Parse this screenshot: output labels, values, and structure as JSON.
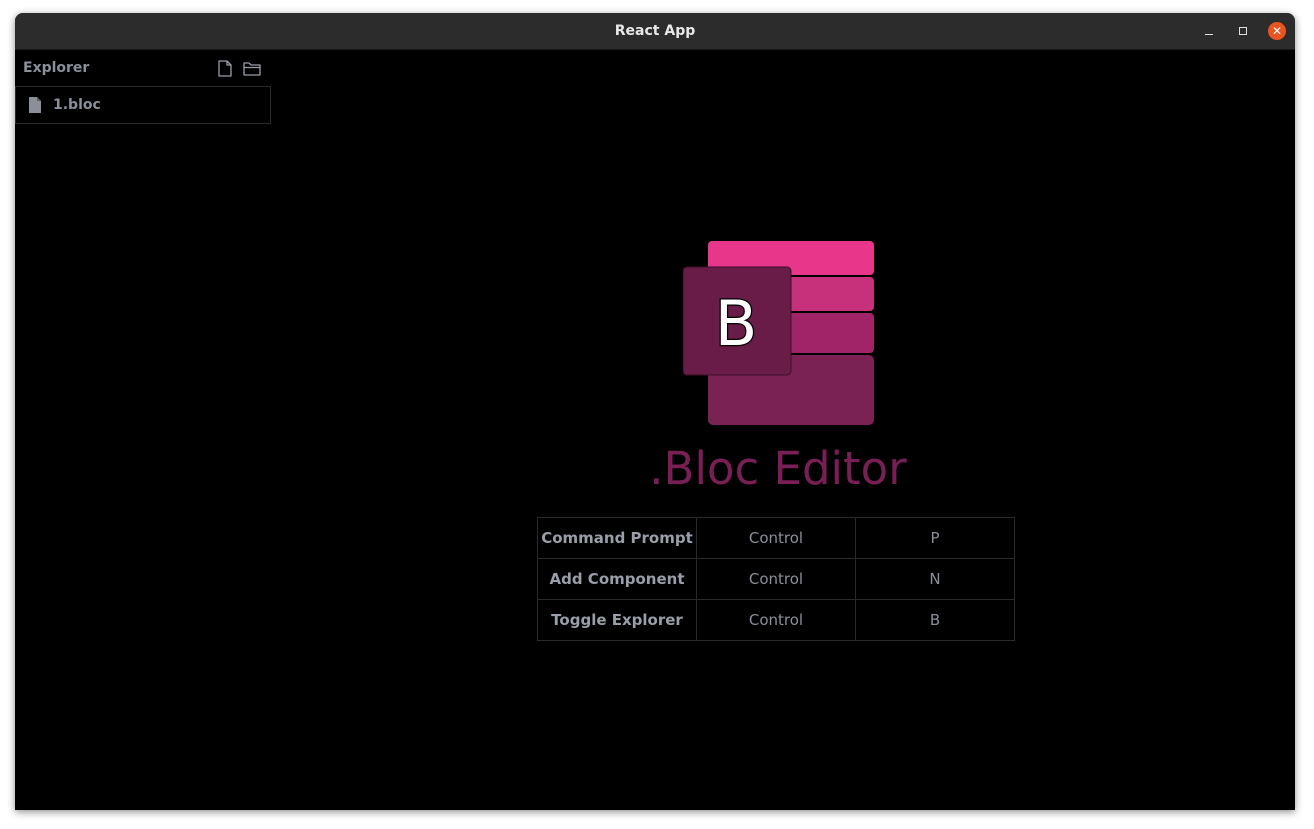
{
  "window": {
    "title": "React App"
  },
  "sidebar": {
    "title": "Explorer",
    "header_icons": [
      "new-file-icon",
      "new-folder-icon"
    ],
    "files": [
      {
        "label": "1.bloc",
        "icon": "file-icon"
      }
    ]
  },
  "main": {
    "logo": {
      "letter": "B",
      "colors": [
        "#e8378a",
        "#c7307b",
        "#a22468",
        "#7b2254",
        "#6a1c48"
      ]
    },
    "brand_title": ".Bloc Editor",
    "shortcuts": [
      {
        "command": "Command Prompt",
        "modifier": "Control",
        "key": "P"
      },
      {
        "command": "Add Component",
        "modifier": "Control",
        "key": "N"
      },
      {
        "command": "Toggle Explorer",
        "modifier": "Control",
        "key": "B"
      }
    ]
  },
  "colors": {
    "accent": "#7a1f55",
    "close_button": "#e95420",
    "muted_text": "#8b8f99"
  }
}
